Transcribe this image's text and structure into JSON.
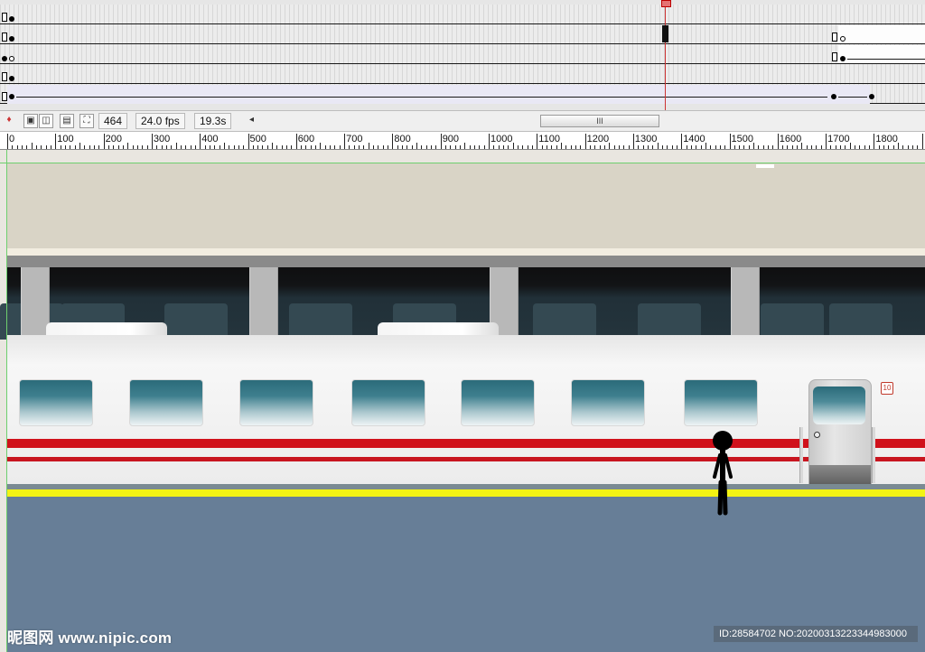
{
  "timeline": {
    "current_frame": "464",
    "frame_rate": "24.0 fps",
    "elapsed_time": "19.3s",
    "scroll_left_arrow": "◂",
    "scroll_thumb_grip": "III"
  },
  "toolbar_icons": [
    "center-frame-icon",
    "onion-skin-icon",
    "onion-skin-outlines-icon",
    "edit-multiple-frames-icon",
    "modify-onion-markers-icon"
  ],
  "ruler": {
    "labels": [
      "0",
      "100",
      "200",
      "300",
      "400",
      "500",
      "600",
      "700",
      "800",
      "900",
      "1000",
      "1100",
      "1200",
      "1300",
      "1400",
      "1500",
      "1600",
      "1700",
      "1800"
    ]
  },
  "stage": {
    "car_number": "10",
    "colors": {
      "ceiling": "#d9d4c6",
      "train_body": "#f2f2f2",
      "red_stripe": "#d0111b",
      "platform": "#677e97",
      "yellow_line": "#f3f313",
      "guide": "#6ecf6e"
    }
  },
  "watermark": {
    "left": "昵图网 www.nipic.com",
    "right": "ID:28584702 NO:20200313223344983000"
  }
}
